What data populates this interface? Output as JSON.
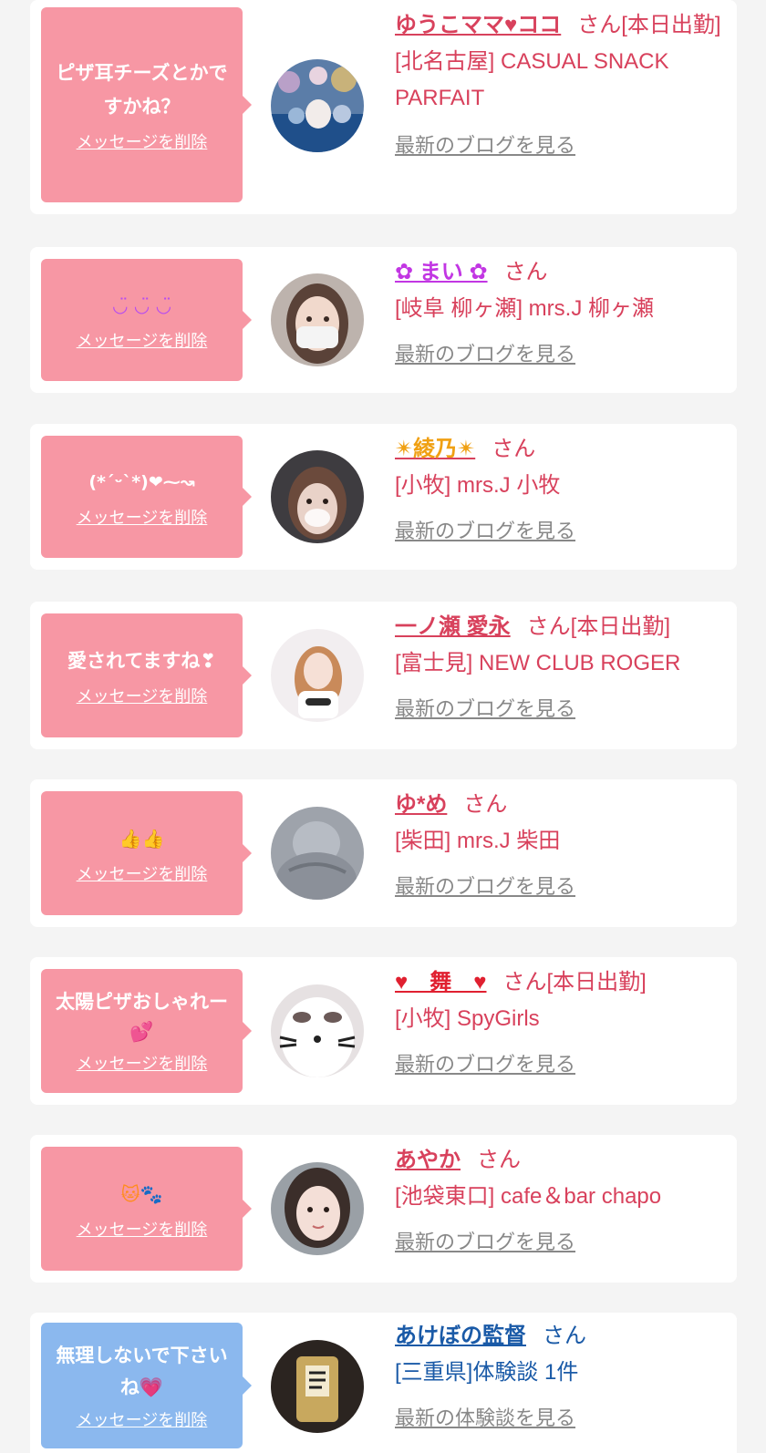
{
  "cards": [
    {
      "message": "ピザ耳チーズとかですかね？",
      "delete_label": "メッセージを削除",
      "name": "ゆうこママ♥ココ",
      "suffix": "さん[本日出勤]",
      "shop": "[北名古屋] CASUAL SNACK PARFAIT",
      "link": "最新のブログを見る"
    },
    {
      "message": "◡̈ ◡̈ ◡̈",
      "delete_label": "メッセージを削除",
      "name": "✿ まい ✿",
      "suffix": "さん",
      "shop": "[岐阜 柳ヶ瀬] mrs.J 柳ヶ瀬",
      "link": "最新のブログを見る"
    },
    {
      "message": "(*ˊᵕˋ*)❤︎⁓↝",
      "delete_label": "メッセージを削除",
      "name": "✴綾乃✴",
      "suffix": "さん",
      "shop": "[小牧] mrs.J 小牧",
      "link": "最新のブログを見る"
    },
    {
      "message": "愛されてますね❣",
      "delete_label": "メッセージを削除",
      "name": "一ノ瀬 愛永",
      "suffix": "さん[本日出勤]",
      "shop": "[富士見] NEW CLUB ROGER",
      "link": "最新のブログを見る"
    },
    {
      "message": "👍👍",
      "delete_label": "メッセージを削除",
      "name": "ゆ*め",
      "suffix": "さん",
      "shop": "[柴田] mrs.J 柴田",
      "link": "最新のブログを見る"
    },
    {
      "message": "太陽ピザおしゃれー💕",
      "delete_label": "メッセージを削除",
      "name": "♥　舞　♥",
      "suffix": "さん[本日出勤]",
      "shop": "[小牧] SpyGirls",
      "link": "最新のブログを見る"
    },
    {
      "message": "🐱🐾",
      "delete_label": "メッセージを削除",
      "name": "あやか",
      "suffix": "さん",
      "shop": "[池袋東口] cafe＆bar chapo",
      "link": "最新のブログを見る"
    },
    {
      "message": "無理しないで下さいね💗",
      "delete_label": "メッセージを削除",
      "name": "あけぼの監督",
      "suffix": "さん",
      "shop": "[三重県]体験談 1件",
      "link": "最新の体験談を見る"
    }
  ],
  "colors": {
    "bubble_pink": "#f797a4",
    "bubble_blue": "#8bb8ee",
    "name_pink": "#d8415c",
    "name_blue": "#1a5aa7",
    "name_purple": "#c236e3",
    "link_gray": "#888888"
  }
}
